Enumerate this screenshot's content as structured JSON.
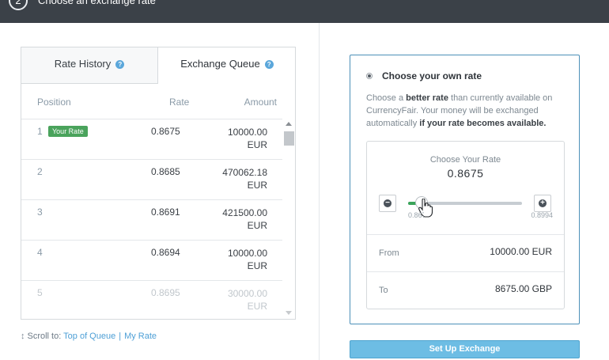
{
  "header": {
    "step_number": "2",
    "title": "Choose an exchange rate"
  },
  "queue": {
    "tabs": [
      {
        "label": "Rate History",
        "active": false
      },
      {
        "label": "Exchange Queue",
        "active": true
      }
    ],
    "columns": {
      "position": "Position",
      "rate": "Rate",
      "amount": "Amount"
    },
    "rows": [
      {
        "position": "1",
        "badge": "Your Rate",
        "rate": "0.8675",
        "amount": "10000.00",
        "currency": "EUR"
      },
      {
        "position": "2",
        "rate": "0.8685",
        "amount": "470062.18",
        "currency": "EUR"
      },
      {
        "position": "3",
        "rate": "0.8691",
        "amount": "421500.00",
        "currency": "EUR"
      },
      {
        "position": "4",
        "rate": "0.8694",
        "amount": "10000.00",
        "currency": "EUR"
      },
      {
        "position": "5",
        "rate": "0.8695",
        "amount": "30000.00",
        "currency": "EUR"
      }
    ],
    "scroll_to": {
      "label": "Scroll to:",
      "top_link": "Top of Queue",
      "separator": "|",
      "my_rate_link": "My Rate"
    }
  },
  "rate_panel": {
    "option_title": "Choose your own rate",
    "description": {
      "part1": "Choose a ",
      "bold1": "better rate",
      "part2": " than currently available on CurrencyFair. Your money will be exchanged automatically ",
      "bold2": "if your rate becomes available."
    },
    "slider": {
      "label": "Choose Your Rate",
      "value": "0.8675",
      "min_label": "0.8675",
      "max_label": "0.8994",
      "position_fraction": 0.06
    },
    "from": {
      "label": "From",
      "value": "10000.00 EUR"
    },
    "to": {
      "label": "To",
      "value": "8675.00 GBP"
    }
  },
  "actions": {
    "setup_label": "Set Up Exchange"
  },
  "colors": {
    "accent": "#4c90b8",
    "badge": "#4aa35c",
    "button": "#6dbde4",
    "link": "#4d9fd6"
  }
}
